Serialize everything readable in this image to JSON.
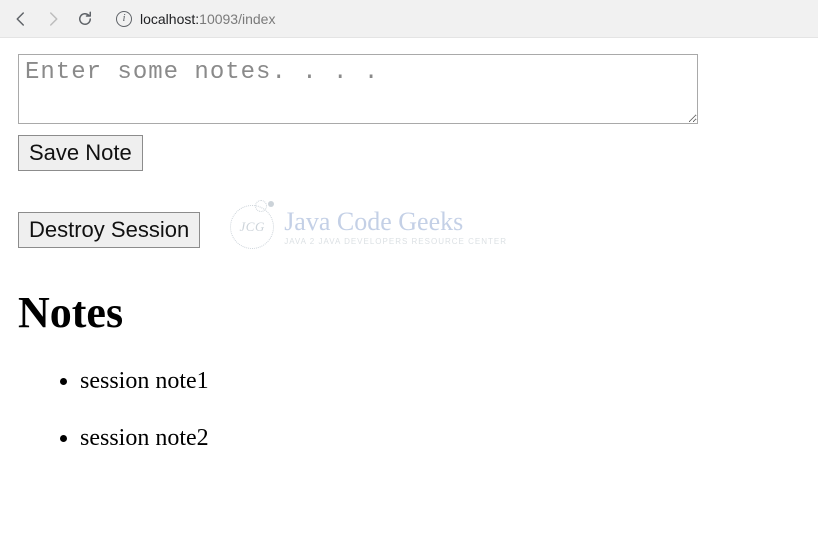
{
  "browser": {
    "url_host": "localhost:",
    "url_port_path": "10093/index"
  },
  "form": {
    "placeholder": "Enter some notes. . . .",
    "value": "",
    "save_label": "Save Note",
    "destroy_label": "Destroy Session"
  },
  "watermark": {
    "title": "Java Code Geeks",
    "subtitle": "Java 2 Java Developers Resource Center"
  },
  "notes": {
    "heading": "Notes",
    "items": [
      "session note1",
      "session note2"
    ]
  }
}
